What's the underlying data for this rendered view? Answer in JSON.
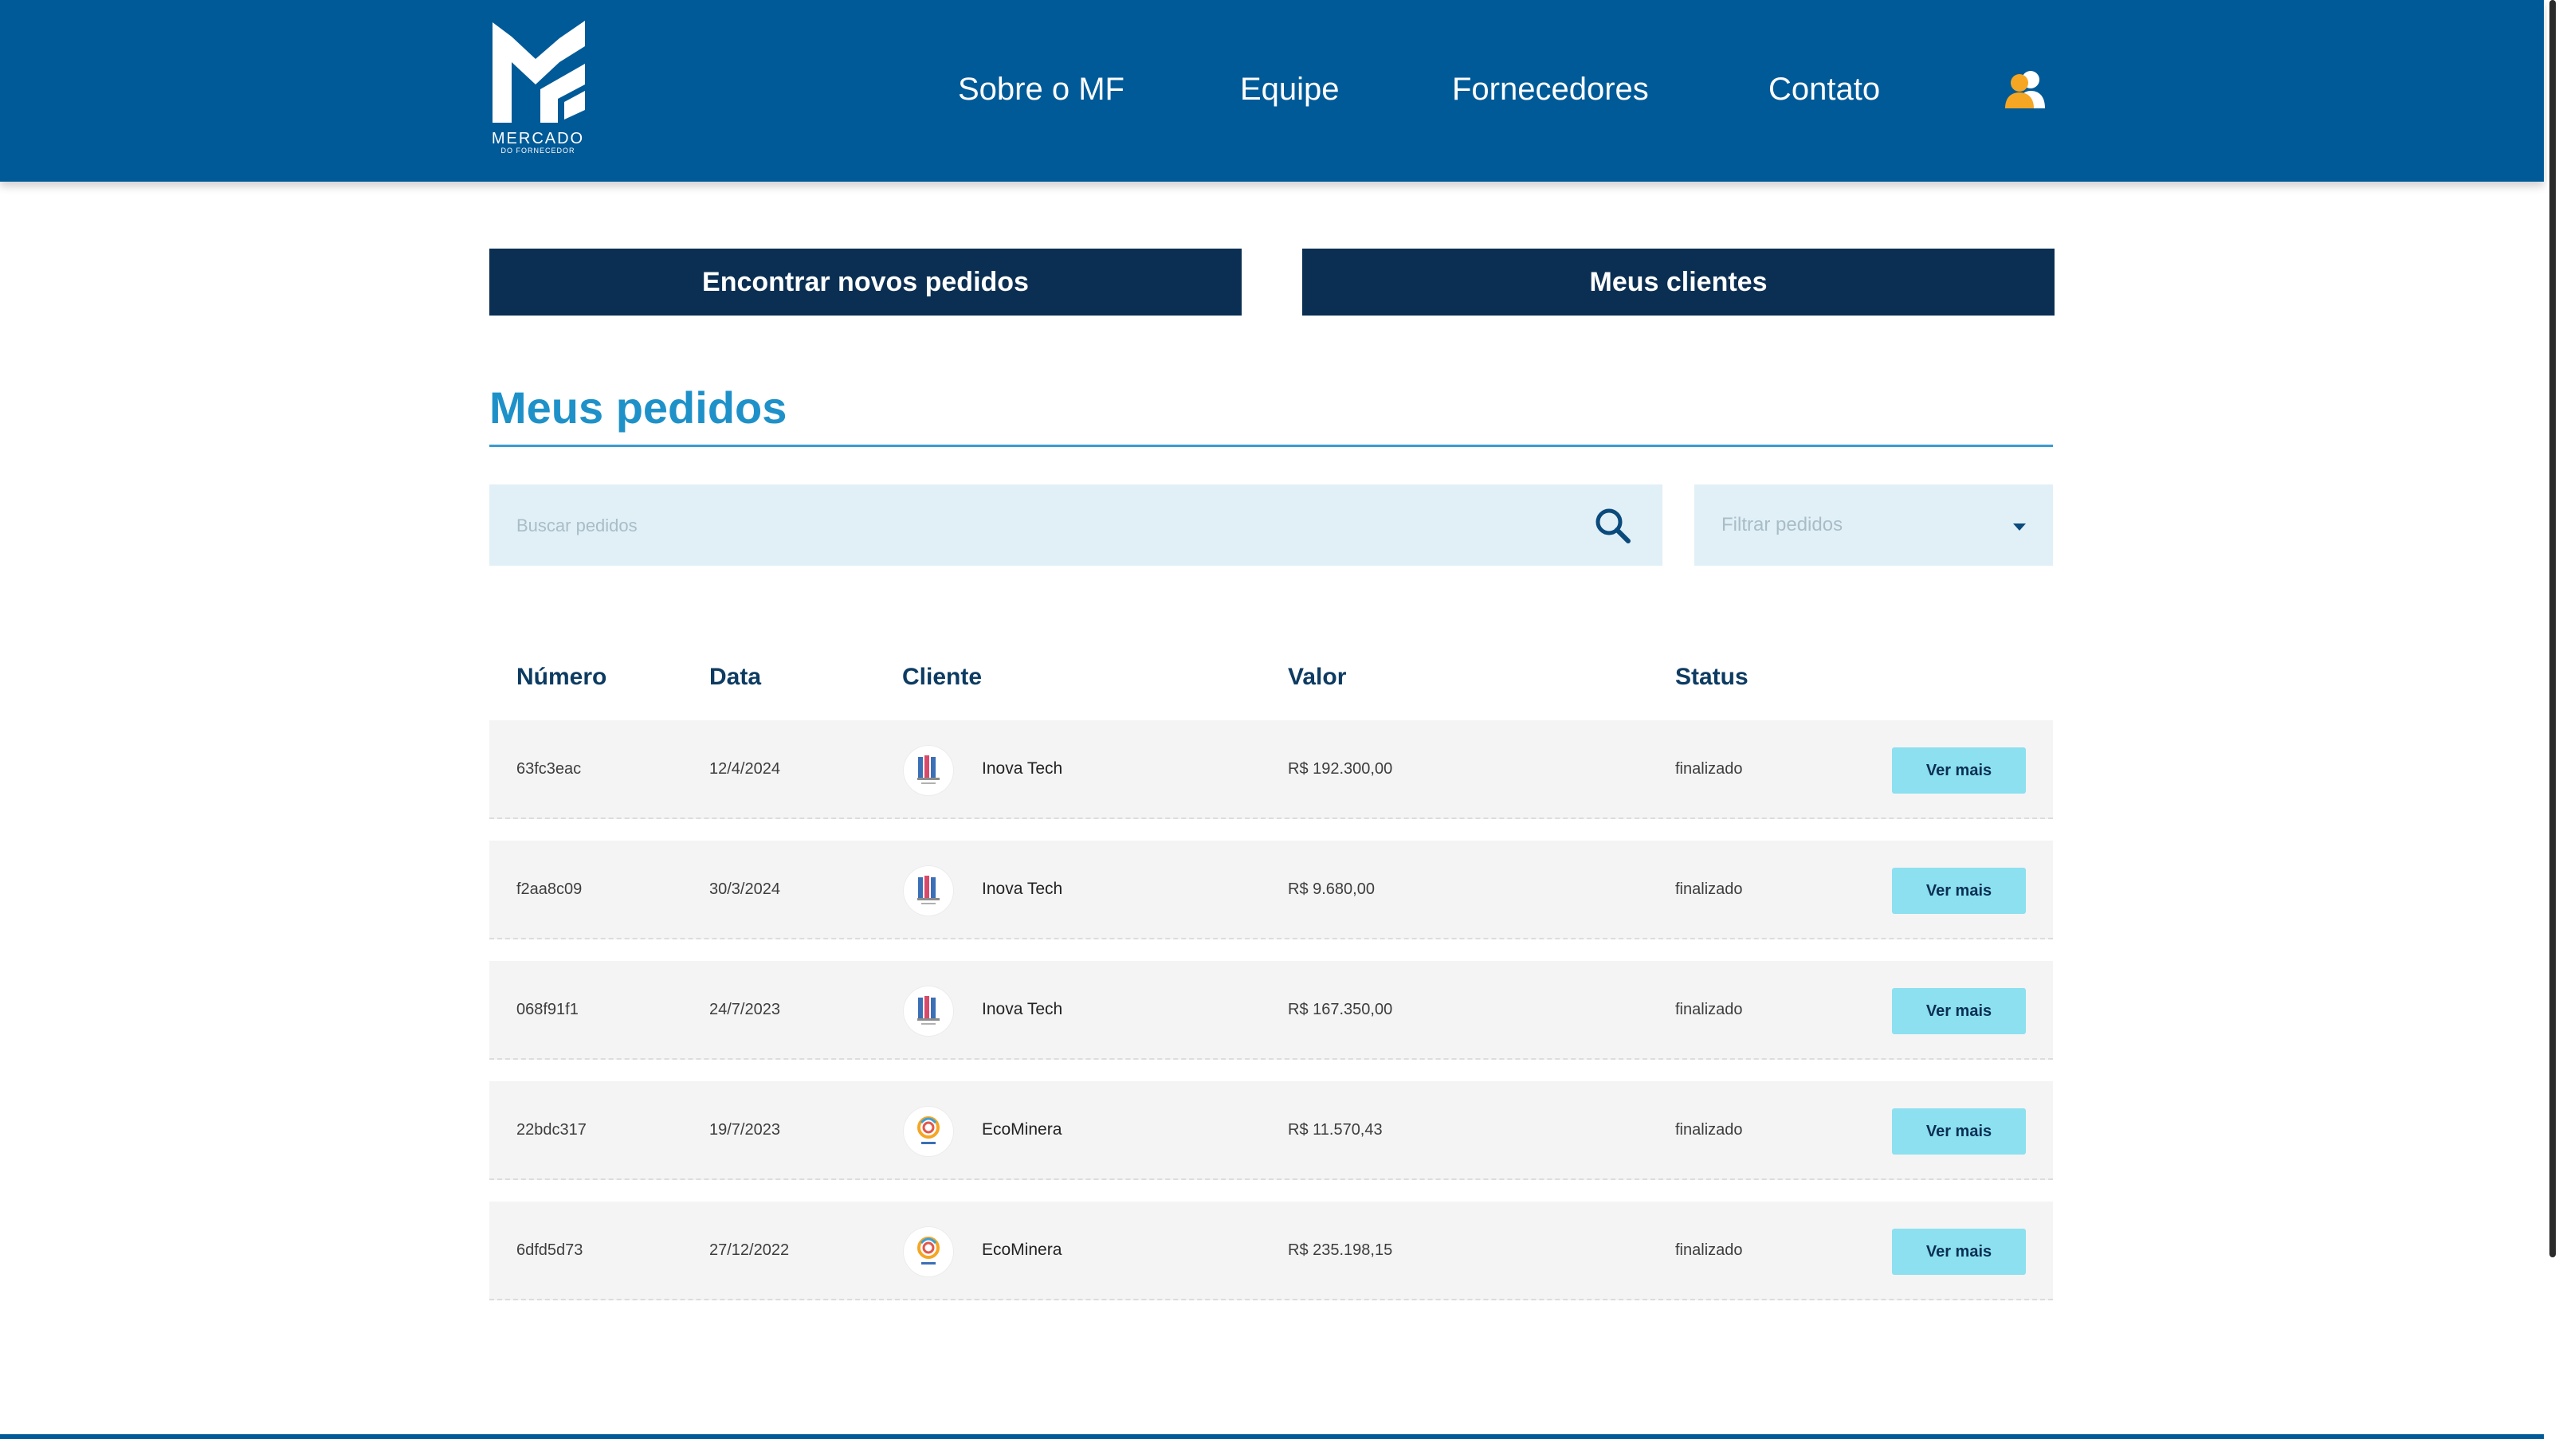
{
  "brand": {
    "logo_text": "MERCADO",
    "logo_subtext": "DO FORNECEDOR",
    "primary_color": "#005a98",
    "dark_color": "#0b2f53",
    "accent_color": "#1e91c9",
    "button_color": "#8ce0f0"
  },
  "nav": {
    "items": [
      {
        "label": "Sobre o MF"
      },
      {
        "label": "Equipe"
      },
      {
        "label": "Fornecedores"
      },
      {
        "label": "Contato"
      }
    ],
    "user_icon": "users-icon"
  },
  "actions": {
    "find_orders": "Encontrar novos pedidos",
    "my_clients": "Meus clientes"
  },
  "page": {
    "title": "Meus pedidos"
  },
  "search": {
    "placeholder": "Buscar pedidos",
    "icon": "search-icon"
  },
  "filter": {
    "label": "Filtrar pedidos",
    "icon": "chevron-down-icon"
  },
  "table": {
    "columns": [
      "Número",
      "Data",
      "Cliente",
      "Valor",
      "Status"
    ],
    "rows": [
      {
        "numero": "63fc3eac",
        "data": "12/4/2024",
        "cliente": "Inova Tech",
        "client_logo": "inova-tech-logo",
        "valor": "R$ 192.300,00",
        "status": "finalizado",
        "action": "Ver mais"
      },
      {
        "numero": "f2aa8c09",
        "data": "30/3/2024",
        "cliente": "Inova Tech",
        "client_logo": "inova-tech-logo",
        "valor": "R$ 9.680,00",
        "status": "finalizado",
        "action": "Ver mais"
      },
      {
        "numero": "068f91f1",
        "data": "24/7/2023",
        "cliente": "Inova Tech",
        "client_logo": "inova-tech-logo",
        "valor": "R$ 167.350,00",
        "status": "finalizado",
        "action": "Ver mais"
      },
      {
        "numero": "22bdc317",
        "data": "19/7/2023",
        "cliente": "EcoMinera",
        "client_logo": "ecominera-logo",
        "valor": "R$ 11.570,43",
        "status": "finalizado",
        "action": "Ver mais"
      },
      {
        "numero": "6dfd5d73",
        "data": "27/12/2022",
        "cliente": "EcoMinera",
        "client_logo": "ecominera-logo",
        "valor": "R$ 235.198,15",
        "status": "finalizado",
        "action": "Ver mais"
      }
    ]
  }
}
